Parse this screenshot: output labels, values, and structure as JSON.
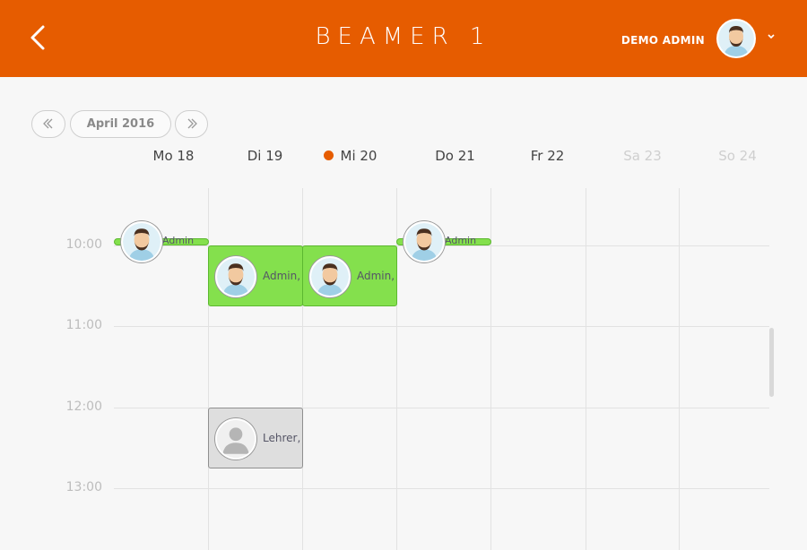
{
  "header": {
    "title": "BEAMER 1",
    "user_name": "DEMO ADMIN",
    "brand_color": "#e65c00",
    "back_icon": "chevron-left-icon",
    "user_menu_icon": "chevron-down-icon"
  },
  "nav": {
    "month_label": "April 2016",
    "prev_icon": "double-chevron-left-icon",
    "next_icon": "double-chevron-right-icon"
  },
  "days": [
    {
      "label": "Mo 18",
      "today": false,
      "weekend": false
    },
    {
      "label": "Di 19",
      "today": false,
      "weekend": false
    },
    {
      "label": "Mi 20",
      "today": true,
      "weekend": false
    },
    {
      "label": "Do 21",
      "today": false,
      "weekend": false
    },
    {
      "label": "Fr 22",
      "today": false,
      "weekend": false
    },
    {
      "label": "Sa 23",
      "today": false,
      "weekend": true
    },
    {
      "label": "So 24",
      "today": false,
      "weekend": true
    }
  ],
  "times": [
    "10:00",
    "11:00",
    "12:00",
    "13:00"
  ],
  "events": [
    {
      "day": "Mo 18",
      "label": "Admin",
      "kind": "short",
      "color": "#84e04d"
    },
    {
      "day": "Di 19",
      "label": "Admin,",
      "kind": "block",
      "color": "#84e04d"
    },
    {
      "day": "Mi 20",
      "label": "Admin,",
      "kind": "block",
      "color": "#84e04d"
    },
    {
      "day": "Do 21",
      "label": "Admin",
      "kind": "short",
      "color": "#84e04d"
    },
    {
      "day": "Di 19",
      "label": "Lehrer,",
      "kind": "block",
      "color": "#dedede"
    }
  ]
}
